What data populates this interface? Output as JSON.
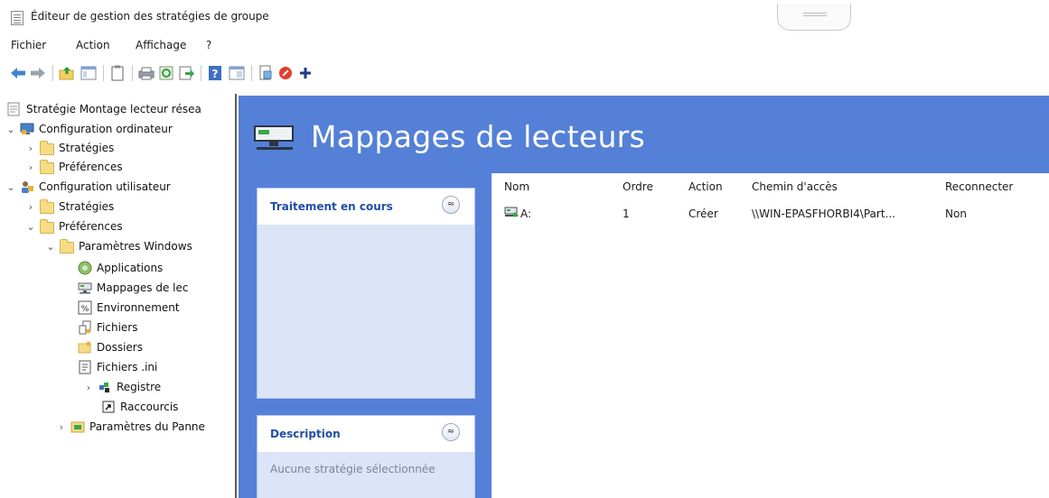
{
  "window": {
    "title": "Éditeur de gestion des stratégies de groupe"
  },
  "menu": [
    "Fichier",
    "Action",
    "Affichage",
    "?"
  ],
  "toolbar": {
    "buttons": [
      "back-arrow-icon",
      "forward-arrow-icon",
      "up-folder-icon",
      "show-hide-tree-icon",
      "properties-icon",
      "print-icon",
      "refresh-icon",
      "export-icon",
      "help-icon",
      "view-icon",
      "new-item-icon",
      "stop-icon",
      "add-icon"
    ]
  },
  "tree": {
    "root": "Stratégie Montage lecteur résea",
    "computer_config": "Configuration ordinateur",
    "cc_strategies": "Stratégies",
    "cc_preferences": "Préférences",
    "user_config": "Configuration utilisateur",
    "uc_strategies": "Stratégies",
    "uc_preferences": "Préférences",
    "windows_settings": "Paramètres Windows",
    "applications": "Applications",
    "drive_maps": "Mappages de lec",
    "environment": "Environnement",
    "files": "Fichiers",
    "folders": "Dossiers",
    "ini_files": "Fichiers .ini",
    "registry": "Registre",
    "shortcuts": "Raccourcis",
    "control_panel": "Paramètres du Panne"
  },
  "main": {
    "title": "Mappages de lecteurs",
    "processing_card": {
      "title": "Traitement en cours",
      "collapse_symbol": "≈"
    },
    "description_card": {
      "title": "Description",
      "collapse_symbol": "≈",
      "text": "Aucune stratégie sélectionnée"
    }
  },
  "list": {
    "columns": [
      "Nom",
      "Ordre",
      "Action",
      "Chemin d'accès",
      "Reconnecter"
    ],
    "rows": [
      {
        "name": "A:",
        "order": "1",
        "action": "Créer",
        "path": "\\\\WIN-EPASFHORBI4\\Part...",
        "reconnect": "Non"
      }
    ]
  },
  "colors": {
    "banner": "#5480d8",
    "card_title": "#1f4fa3",
    "card_body": "#dbe5f7"
  }
}
